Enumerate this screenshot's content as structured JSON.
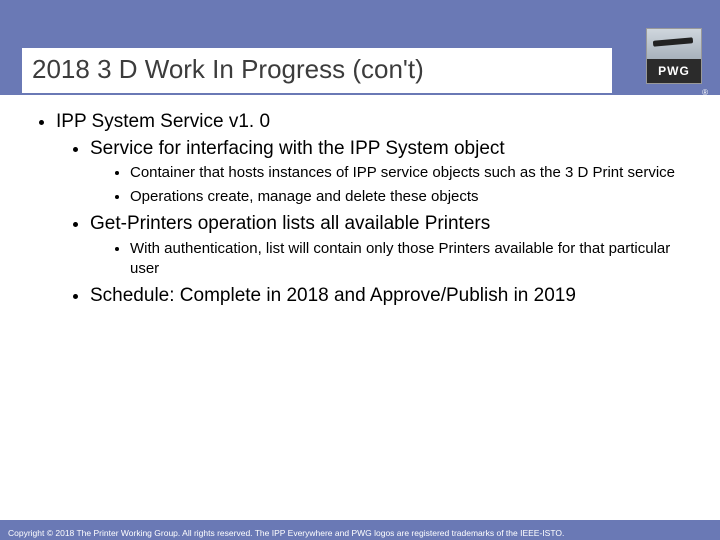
{
  "header": {
    "title": "2018 3 D Work In Progress (con't)",
    "logo_text": "PWG",
    "trademark": "®"
  },
  "bullets": {
    "l1_1": "IPP System Service v1. 0",
    "l2_1": "Service for interfacing with the IPP System object",
    "l3_1": "Container that hosts instances of IPP service objects such as the 3 D Print service",
    "l3_2": "Operations create, manage and delete these objects",
    "l2_2": "Get-Printers operation lists all available Printers",
    "l3_3": "With authentication, list will contain only those Printers available for that particular user",
    "l2_3": "Schedule: Complete in 2018 and Approve/Publish in 2019"
  },
  "footer": {
    "text": "Copyright © 2018 The Printer Working Group. All rights reserved. The IPP Everywhere and PWG logos are registered trademarks of the IEEE-ISTO."
  }
}
